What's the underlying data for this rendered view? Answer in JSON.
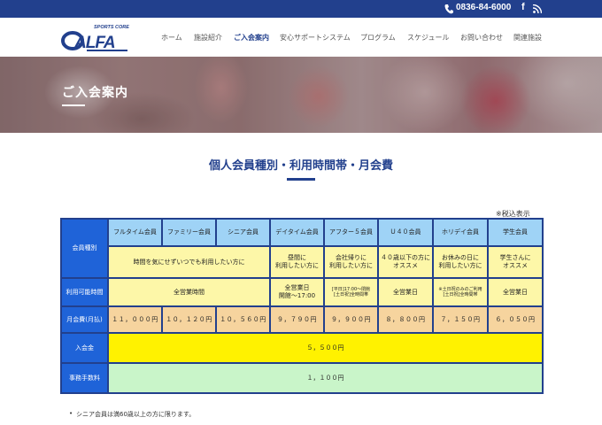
{
  "topbar": {
    "phone": "0836-84-6000",
    "facebook_label": "f",
    "phone_icon": "phone-icon",
    "rss_icon": "rss-icon"
  },
  "logo": {
    "tagline": "SPORTS CORE",
    "name": "ALFA"
  },
  "nav": [
    {
      "label": "ホーム",
      "active": false
    },
    {
      "label": "施設紹介",
      "active": false
    },
    {
      "label": "ご入会案内",
      "active": true
    },
    {
      "label": "安心サポートシステム",
      "active": false
    },
    {
      "label": "プログラム",
      "active": false
    },
    {
      "label": "スケジュール",
      "active": false
    },
    {
      "label": "お問い合わせ",
      "active": false
    },
    {
      "label": "関連施設",
      "active": false
    }
  ],
  "hero": {
    "title": "ご入会案内"
  },
  "section": {
    "title": "個人会員種別・利用時間帯・月会費",
    "tax_note": "※税込表示"
  },
  "table": {
    "row_headers": {
      "type": "会員種別",
      "hours": "利用可能時間",
      "monthly_fee": "月会費(月払)",
      "join_fee": "入会金",
      "admin_fee": "事務手数料"
    },
    "plans": [
      "フルタイム会員",
      "ファミリー会員",
      "シニア会員",
      "デイタイム会員",
      "アフター５会員",
      "Ｕ４０会員",
      "ホリデイ会員",
      "学生会員"
    ],
    "targets": {
      "shared": "時間を気にせずいつでも利用したい方に",
      "daytime": [
        "昼間に",
        "利用したい方に"
      ],
      "after5": [
        "会社帰りに",
        "利用したい方に"
      ],
      "u40": [
        "４０歳以下の方に",
        "オススメ"
      ],
      "holiday": [
        "お休みの日に",
        "利用したい方に"
      ],
      "student": [
        "学生さんに",
        "オススメ"
      ]
    },
    "hours": {
      "shared": "全営業時間",
      "daytime": [
        "全営業日",
        "開館～17:00"
      ],
      "after5": [
        "[平日]17:00～閉館",
        "[土日祝]全時間帯"
      ],
      "u40": "全営業日",
      "holiday": [
        "※土日祝のみのご利用",
        "[土日祝]全時間帯"
      ],
      "student": "全営業日"
    },
    "fees": [
      "１１，０００円",
      "１０，１２０円",
      "１０，５６０円",
      "９，７９０円",
      "９，９００円",
      "８，８００円",
      "７，１５０円",
      "６，０５０円"
    ],
    "join_fee": "５，５００円",
    "admin_fee": "１，１００円"
  },
  "notes": [
    "シニア会員は満60歳以上の方に限ります。"
  ],
  "colors": {
    "brand": "#22408d",
    "header_cell": "#1f63d8",
    "plan_cell": "#9fd3f6",
    "target_cell": "#fdf7a8",
    "fee_cell": "#f6d49e",
    "join_cell": "#fff200",
    "admin_cell": "#c9f5c9"
  }
}
